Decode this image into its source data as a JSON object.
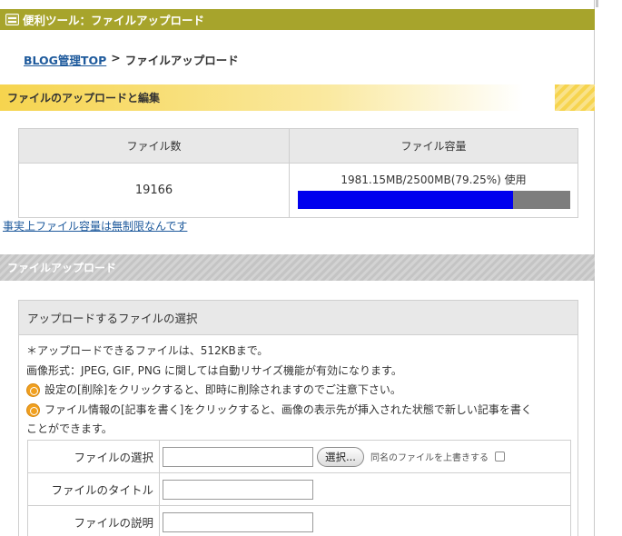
{
  "header": {
    "title": "便利ツール：ファイルアップロード",
    "icon": "tool-box-icon"
  },
  "breadcrumb": {
    "link": "BLOG管理TOP",
    "separator": ">",
    "current": "ファイルアップロード"
  },
  "section_edit": {
    "title": "ファイルのアップロードと編集"
  },
  "stats": {
    "col_count": "ファイル数",
    "col_capacity": "ファイル容量",
    "file_count": "19166",
    "usage_text": "1981.15MB/2500MB(79.25%) 使用",
    "usage_ratio": 0.7925,
    "bar_fill_color": "#0000ee",
    "bar_bg_color": "#7d7d7d"
  },
  "unlimited_link": "事実上ファイル容量は無制限なんです",
  "section_upload": {
    "title": "ファイルアップロード"
  },
  "upload": {
    "box_title": "アップロードするファイルの選択",
    "note1": "＊アップロードできるファイルは、512KBまで。",
    "note2": "画像形式：JPEG, GIF, PNG に関しては自動リサイズ機能が有効になります。",
    "note3": "設定の[削除]をクリックすると、即時に削除されますのでご注意下さい。",
    "note4a": "ファイル情報の[記事を書く]をクリックすると、画像の表示先が挿入された状態で新しい記事を書く",
    "note4b": "ことができます。",
    "label_file": "ファイルの選択",
    "select_button": "選択...",
    "overwrite_label": "同名のファイルを上書きする",
    "label_title": "ファイルのタイトル",
    "label_desc": "ファイルの説明"
  },
  "colors": {
    "header": "#a7a42c",
    "accent_yellow": "#f6d44e",
    "link": "#1e5a9c"
  }
}
